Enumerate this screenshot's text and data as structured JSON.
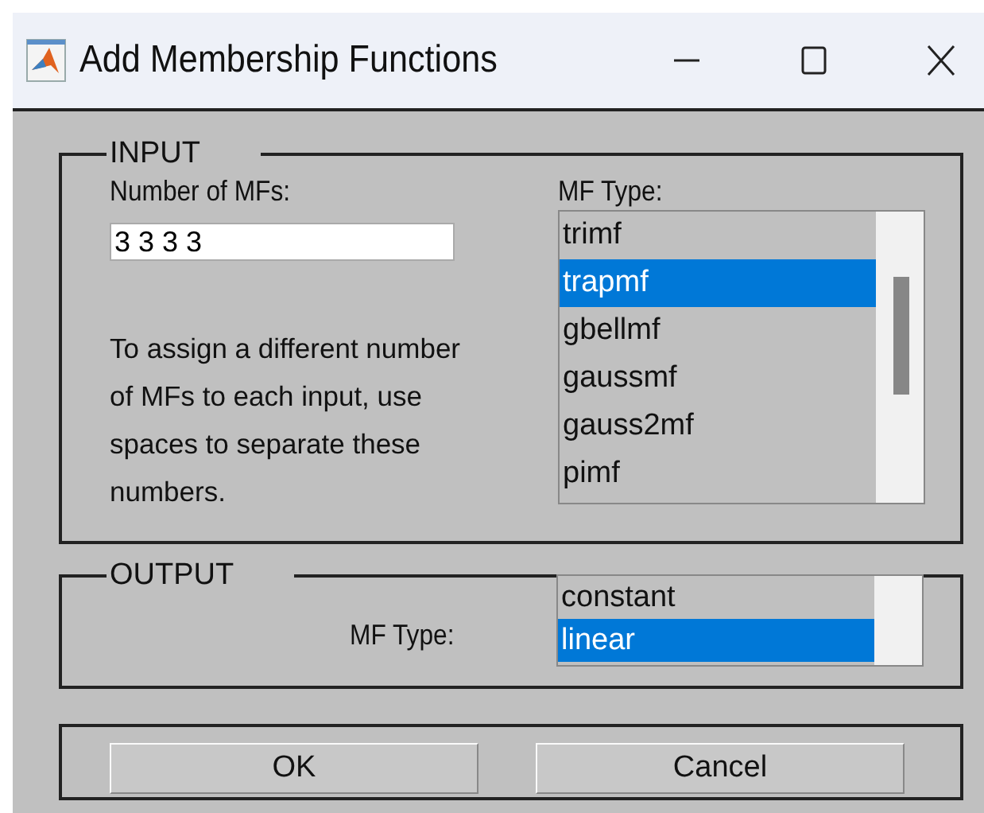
{
  "window": {
    "title": "Add Membership Functions"
  },
  "input": {
    "legend": "INPUT",
    "count_label": "Number of MFs:",
    "count_value": "3 3 3 3",
    "hint": "To assign a different number of MFs to each input, use spaces to separate these numbers.",
    "type_label": "MF Type:",
    "types": [
      {
        "label": "trimf",
        "selected": false
      },
      {
        "label": "trapmf",
        "selected": true
      },
      {
        "label": "gbellmf",
        "selected": false
      },
      {
        "label": "gaussmf",
        "selected": false
      },
      {
        "label": "gauss2mf",
        "selected": false
      },
      {
        "label": "pimf",
        "selected": false
      }
    ]
  },
  "output": {
    "legend": "OUTPUT",
    "type_label": "MF Type:",
    "types": [
      {
        "label": "constant",
        "selected": false
      },
      {
        "label": "linear",
        "selected": true
      }
    ]
  },
  "buttons": [
    "OK",
    "Cancel"
  ]
}
